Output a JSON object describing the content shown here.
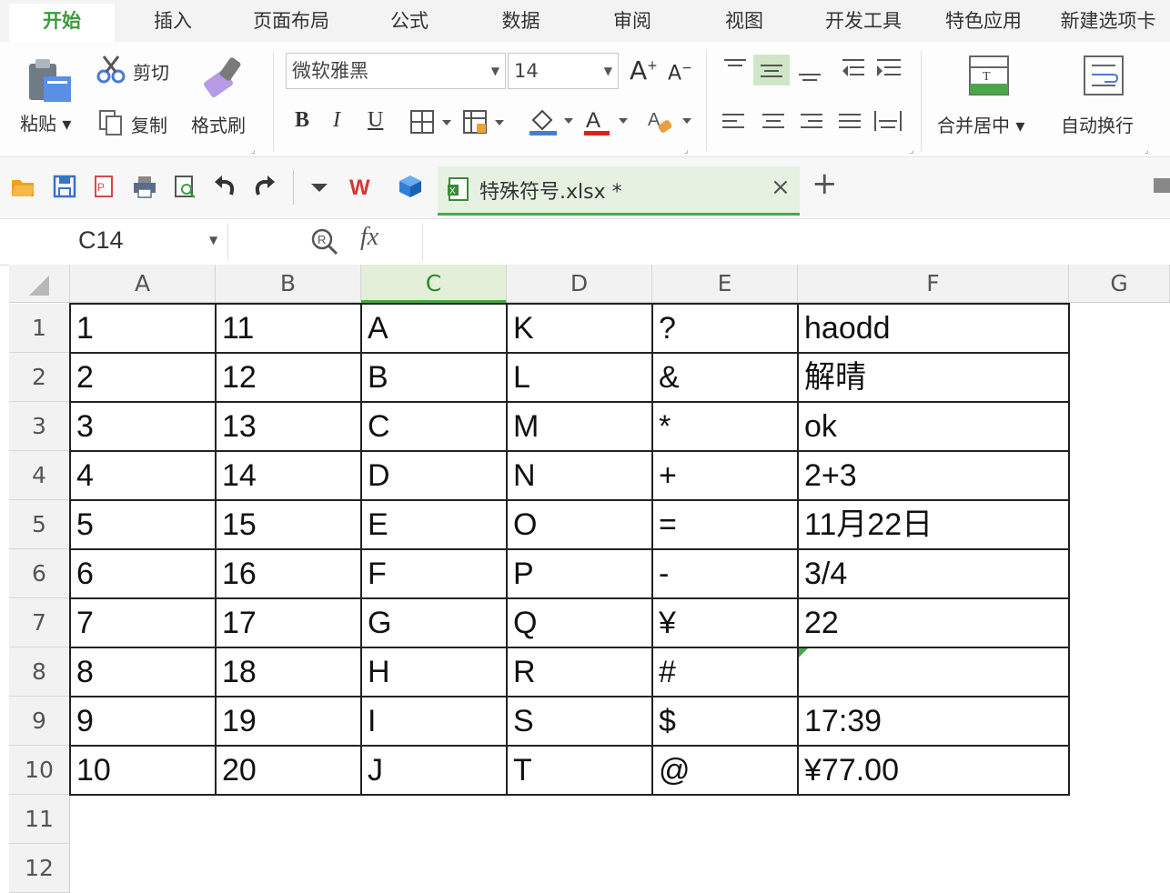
{
  "ribbon_tabs": [
    "开始",
    "插入",
    "页面布局",
    "公式",
    "数据",
    "审阅",
    "视图",
    "开发工具",
    "特色应用",
    "新建选项卡"
  ],
  "clipboard": {
    "paste": "粘贴",
    "cut": "剪切",
    "copy": "复制",
    "format_painter": "格式刷"
  },
  "font": {
    "name": "微软雅黑",
    "size": "14",
    "bold": "B",
    "italic": "I",
    "underline": "U",
    "grow": "A",
    "shrink": "A"
  },
  "merge": {
    "merge_center": "合并居中",
    "wrap": "自动换行"
  },
  "document_tab": {
    "title": "特殊符号.xlsx *"
  },
  "formula_bar": {
    "name_box": "C14",
    "fx": "fx",
    "value": ""
  },
  "sheet": {
    "columns": [
      "A",
      "B",
      "C",
      "D",
      "E",
      "F",
      "G"
    ],
    "selected_column": "C",
    "row_numbers": [
      "1",
      "2",
      "3",
      "4",
      "5",
      "6",
      "7",
      "8",
      "9",
      "10",
      "11",
      "12"
    ],
    "rows": [
      [
        "1",
        "11",
        "A",
        "K",
        "?",
        "haodd"
      ],
      [
        "2",
        "12",
        "B",
        "L",
        "&",
        "解晴"
      ],
      [
        "3",
        "13",
        "C",
        "M",
        "*",
        "ok"
      ],
      [
        "4",
        "14",
        "D",
        "N",
        "+",
        "2+3"
      ],
      [
        "5",
        "15",
        "E",
        "O",
        "=",
        "11月22日"
      ],
      [
        "6",
        "16",
        "F",
        "P",
        "-",
        "3/4"
      ],
      [
        "7",
        "17",
        "G",
        "Q",
        "¥",
        "22"
      ],
      [
        "8",
        "18",
        "H",
        "R",
        "#",
        ""
      ],
      [
        "9",
        "19",
        "I",
        "S",
        "$",
        "17:39"
      ],
      [
        "10",
        "20",
        "J",
        "T",
        "@",
        "¥77.00"
      ]
    ]
  },
  "colors": {
    "accent": "#4aa64a",
    "tab_active": "#3c9a3c"
  }
}
